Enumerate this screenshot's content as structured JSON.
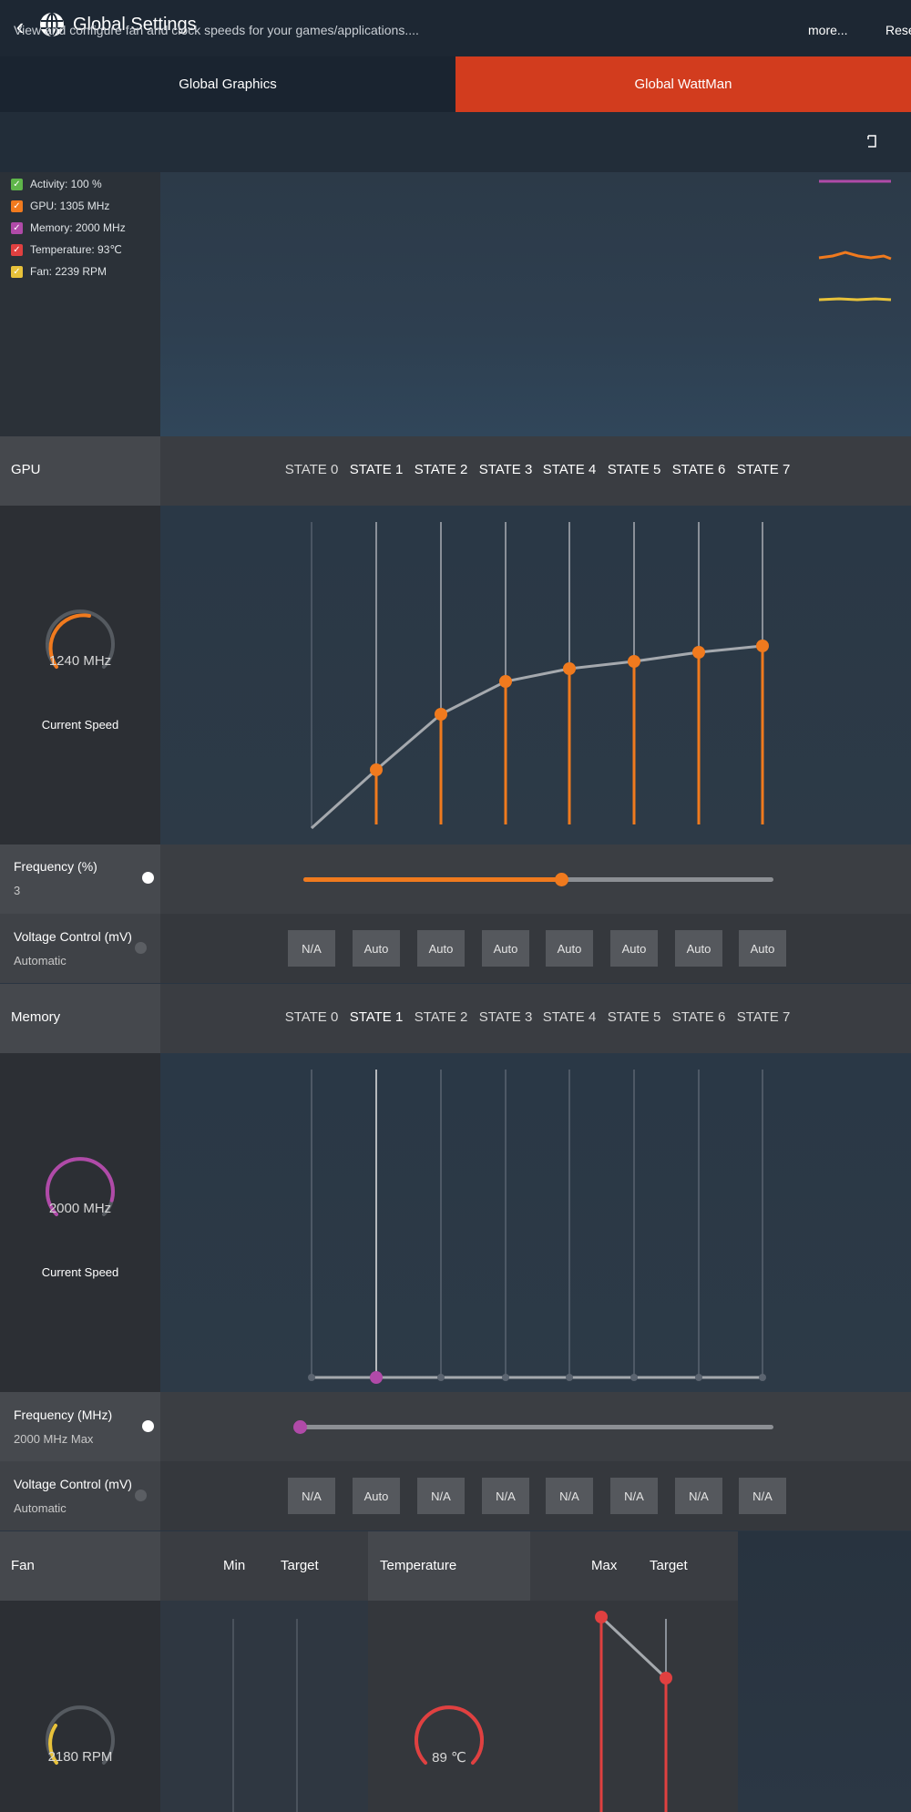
{
  "header": {
    "title": "Global Settings"
  },
  "tabs": [
    {
      "label": "Global Graphics"
    },
    {
      "label": "Global WattMan"
    }
  ],
  "description": "View and configure fan and clock speeds for your games/applications....",
  "more_label": "more...",
  "reset_label": "Reset",
  "legend": [
    {
      "label": "Activity: 100 %",
      "color": "#5fb54a"
    },
    {
      "label": "GPU: 1305 MHz",
      "color": "#f07a1e"
    },
    {
      "label": "Memory: 2000 MHz",
      "color": "#b04aa8"
    },
    {
      "label": "Temperature: 93℃",
      "color": "#e04040"
    },
    {
      "label": "Fan: 2239 RPM",
      "color": "#e8c23a"
    }
  ],
  "gpu": {
    "title": "GPU",
    "states": [
      "STATE 0",
      "STATE 1",
      "STATE 2",
      "STATE 3",
      "STATE 4",
      "STATE 5",
      "STATE 6",
      "STATE 7"
    ],
    "gauge_value": "1240 MHz",
    "gauge_label": "Current Speed",
    "frequency_label": "Frequency (%)",
    "frequency_value": "3",
    "voltage_label": "Voltage Control (mV)",
    "voltage_value": "Automatic",
    "voltage_buttons": [
      "N/A",
      "Auto",
      "Auto",
      "Auto",
      "Auto",
      "Auto",
      "Auto",
      "Auto"
    ]
  },
  "memory": {
    "title": "Memory",
    "states": [
      "STATE 0",
      "STATE 1",
      "STATE 2",
      "STATE 3",
      "STATE 4",
      "STATE 5",
      "STATE 6",
      "STATE 7"
    ],
    "gauge_value": "2000 MHz",
    "gauge_label": "Current Speed",
    "frequency_label": "Frequency (MHz)",
    "frequency_value": "2000 MHz Max",
    "voltage_label": "Voltage Control (mV)",
    "voltage_value": "Automatic",
    "voltage_buttons": [
      "N/A",
      "Auto",
      "N/A",
      "N/A",
      "N/A",
      "N/A",
      "N/A",
      "N/A"
    ]
  },
  "fan": {
    "title": "Fan",
    "col_min": "Min",
    "col_target": "Target",
    "gauge_value": "2180 RPM"
  },
  "temperature": {
    "title": "Temperature",
    "col_max": "Max",
    "col_target": "Target",
    "gauge_value": "89 ℃"
  },
  "colors": {
    "accent": "#d23c1e",
    "gpu": "#f07a1e",
    "memory": "#b04aa8",
    "temp": "#e04040",
    "fan": "#e8c23a"
  }
}
